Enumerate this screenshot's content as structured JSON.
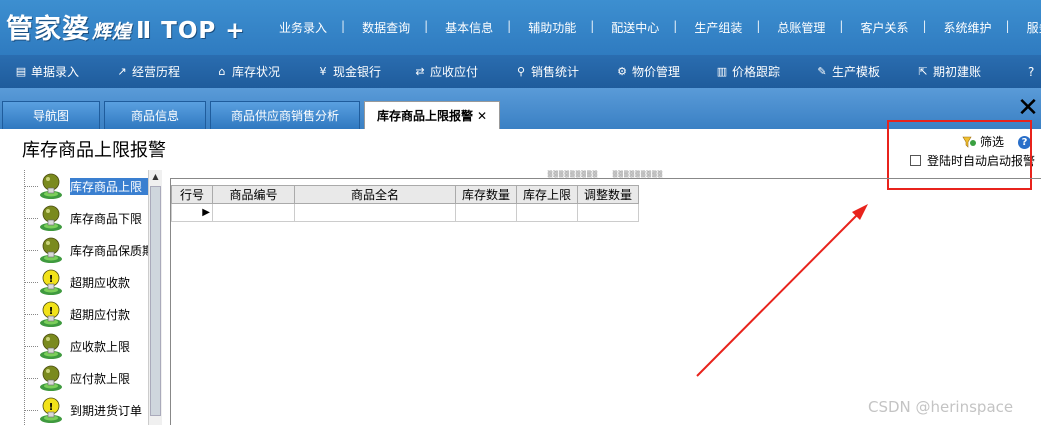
{
  "app": {
    "logo_main": "管家婆",
    "logo_sub": "辉煌",
    "logo_version": "Ⅱ TOP +"
  },
  "top_menu": [
    "业务录入",
    "数据查询",
    "基本信息",
    "辅助功能",
    "配送中心",
    "生产组装",
    "总账管理",
    "客户关系",
    "系统维护",
    "服务"
  ],
  "toolbar": [
    {
      "label": "单据录入",
      "icon": "document-icon"
    },
    {
      "label": "经营历程",
      "icon": "trend-icon"
    },
    {
      "label": "库存状况",
      "icon": "house-icon"
    },
    {
      "label": "现金银行",
      "icon": "yen-icon"
    },
    {
      "label": "应收应付",
      "icon": "exchange-icon"
    },
    {
      "label": "销售统计",
      "icon": "search-icon"
    },
    {
      "label": "物价管理",
      "icon": "gear-icon"
    },
    {
      "label": "价格跟踪",
      "icon": "bar-chart-icon"
    },
    {
      "label": "生产模板",
      "icon": "wrench-icon"
    },
    {
      "label": "期初建账",
      "icon": "export-icon"
    },
    {
      "label": "?",
      "icon": "help-icon"
    }
  ],
  "tabs": [
    {
      "label": "导航图",
      "active": false
    },
    {
      "label": "商品信息",
      "active": false
    },
    {
      "label": "商品供应商销售分析",
      "active": false
    },
    {
      "label": "库存商品上限报警",
      "active": true
    }
  ],
  "page": {
    "title": "库存商品上限报警",
    "filter_label": "筛选",
    "auto_alert_label": "登陆时自动启动报警",
    "auto_alert_checked": false
  },
  "tree": [
    {
      "label": "库存商品上限",
      "type": "normal",
      "selected": true
    },
    {
      "label": "库存商品下限",
      "type": "normal",
      "selected": false
    },
    {
      "label": "库存商品保质期",
      "type": "normal",
      "selected": false
    },
    {
      "label": "超期应收款",
      "type": "warn",
      "selected": false
    },
    {
      "label": "超期应付款",
      "type": "warn",
      "selected": false
    },
    {
      "label": "应收款上限",
      "type": "normal",
      "selected": false
    },
    {
      "label": "应付款上限",
      "type": "normal",
      "selected": false
    },
    {
      "label": "到期进货订单",
      "type": "warn",
      "selected": false
    }
  ],
  "grid": {
    "columns": [
      "行号",
      "商品编号",
      "商品全名",
      "库存数量",
      "库存上限",
      "调整数量"
    ]
  },
  "watermark": "CSDN @herinspace",
  "colors": {
    "title_bar": "#2f7bc0",
    "toolbar": "#1f5c9c",
    "highlight_box": "#e8231c",
    "selected_node": "#3a7fd0"
  }
}
